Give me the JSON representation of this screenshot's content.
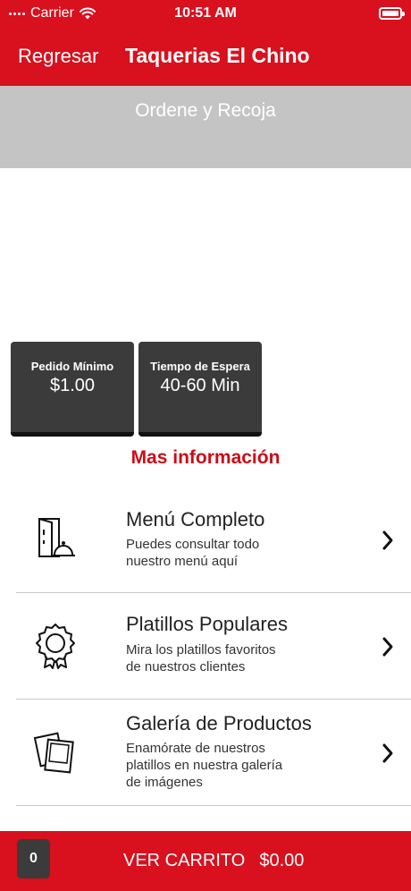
{
  "status_bar": {
    "carrier": "Carrier",
    "time": "10:51 AM"
  },
  "nav": {
    "back_label": "Regresar",
    "title": "Taquerias El Chino"
  },
  "banner": {
    "text": "Ordene y Recoja"
  },
  "info_tiles": [
    {
      "label": "Pedido Mínimo",
      "value": "$1.00"
    },
    {
      "label": "Tiempo de Espera",
      "value": "40-60 Min"
    }
  ],
  "more_info_label": "Mas información",
  "list_items": [
    {
      "title": "Menú Completo",
      "description": "Puedes consultar todo\nnuestro menú aquí",
      "icon": "menu-book-icon"
    },
    {
      "title": "Platillos Populares",
      "description": "Mira los platillos favoritos\nde nuestros clientes",
      "icon": "award-badge-icon"
    },
    {
      "title": "Galería de Productos",
      "description": "Enamórate de nuestros\nplatillos en nuestra galería\nde imágenes",
      "icon": "photo-gallery-icon"
    }
  ],
  "cart": {
    "count": "0",
    "label": "VER CARRITO",
    "total": "$0.00"
  },
  "colors": {
    "brand_red": "#d9101e",
    "banner_gray": "#c4c4c4",
    "tile_dark": "#3b3b3b",
    "link_red": "#cc0c17"
  }
}
